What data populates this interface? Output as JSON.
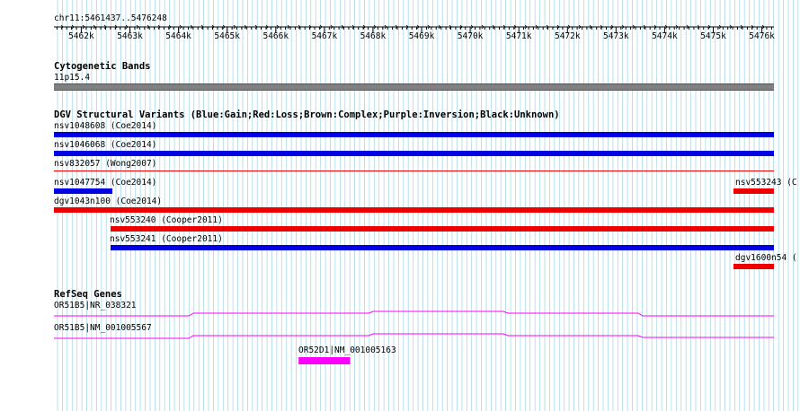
{
  "ruler": {
    "coords": "chr11:5461437..5476248",
    "start": 5461437,
    "end": 5476248,
    "ticks": [
      {
        "pos": 5462000,
        "label": "5462k"
      },
      {
        "pos": 5463000,
        "label": "5463k"
      },
      {
        "pos": 5464000,
        "label": "5464k"
      },
      {
        "pos": 5465000,
        "label": "5465k"
      },
      {
        "pos": 5466000,
        "label": "5466k"
      },
      {
        "pos": 5467000,
        "label": "5467k"
      },
      {
        "pos": 5468000,
        "label": "5468k"
      },
      {
        "pos": 5469000,
        "label": "5469k"
      },
      {
        "pos": 5470000,
        "label": "5470k"
      },
      {
        "pos": 5471000,
        "label": "5471k"
      },
      {
        "pos": 5472000,
        "label": "5472k"
      },
      {
        "pos": 5473000,
        "label": "5473k"
      },
      {
        "pos": 5474000,
        "label": "5474k"
      },
      {
        "pos": 5475000,
        "label": "5475k"
      },
      {
        "pos": 5476000,
        "label": "5476k"
      }
    ]
  },
  "cytoband": {
    "title": "Cytogenetic Bands",
    "band_label": "11p15.4",
    "color": "#808080"
  },
  "dgv": {
    "title": "DGV Structural Variants (Blue:Gain;Red:Loss;Brown:Complex;Purple:Inversion;Black:Unknown)",
    "colors": {
      "gain": "#0000e0",
      "loss": "#ee0000"
    },
    "features": [
      {
        "label": "nsv1048608 (Coe2014)",
        "type": "gain",
        "start": 5461437,
        "end": 5476248,
        "thin": false
      },
      {
        "label": "nsv1046068 (Coe2014)",
        "type": "gain",
        "start": 5461437,
        "end": 5476248,
        "thin": false
      },
      {
        "label": "nsv832057 (Wong2007)",
        "type": "loss",
        "start": 5461437,
        "end": 5476248,
        "thin": true
      },
      {
        "label": "nsv1047754 (Coe2014)",
        "type": "gain",
        "start": 5461437,
        "end": 5462630,
        "thin": false
      },
      {
        "label": "nsv553243 (C",
        "type": "loss",
        "start": 5475420,
        "end": 5476248,
        "thin": false
      },
      {
        "label": "dgv1043n100 (Coe2014)",
        "type": "loss",
        "start": 5461437,
        "end": 5476248,
        "thin": false
      },
      {
        "label": "nsv553240 (Cooper2011)",
        "type": "loss",
        "start": 5462600,
        "end": 5476248,
        "thin": false
      },
      {
        "label": "nsv553241 (Cooper2011)",
        "type": "gain",
        "start": 5462600,
        "end": 5476248,
        "thin": false
      },
      {
        "label": "dgv1600n54 (",
        "type": "loss",
        "start": 5475420,
        "end": 5476248,
        "thin": false
      }
    ]
  },
  "refseq": {
    "title": "RefSeq Genes",
    "color": "#ff00ff",
    "genes": [
      {
        "label": "OR51B5|NR_038321"
      },
      {
        "label": "OR51B5|NM_001005567"
      },
      {
        "label": "OR52D1|NM_001005163",
        "start": 5466470,
        "end": 5467530
      }
    ]
  }
}
